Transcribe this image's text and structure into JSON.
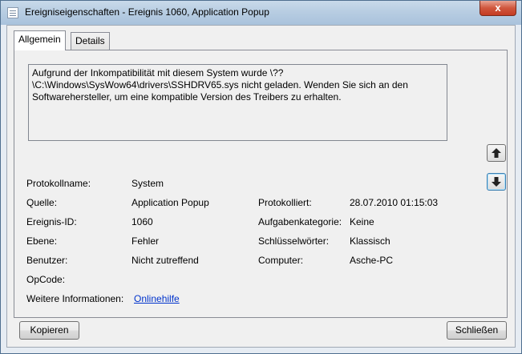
{
  "window": {
    "title": "Ereigniseigenschaften - Ereignis 1060, Application Popup",
    "close_glyph": "x"
  },
  "tabs": [
    {
      "label": "Allgemein",
      "active": true
    },
    {
      "label": "Details",
      "active": false
    }
  ],
  "message": "Aufgrund der Inkompatibilität mit diesem System wurde \\??\\C:\\Windows\\SysWow64\\drivers\\SSHDRV65.sys nicht geladen. Wenden Sie sich an den Softwarehersteller, um eine kompatible Version des Treibers zu erhalten.",
  "fields": {
    "protokollname": {
      "label": "Protokollname:",
      "value": "System"
    },
    "quelle": {
      "label": "Quelle:",
      "value": "Application Popup"
    },
    "protokolliert": {
      "label": "Protokolliert:",
      "value": "28.07.2010 01:15:03"
    },
    "ereignis_id": {
      "label": "Ereignis-ID:",
      "value": "1060"
    },
    "aufgabenkategorie": {
      "label": "Aufgabenkategorie:",
      "value": "Keine"
    },
    "ebene": {
      "label": "Ebene:",
      "value": "Fehler"
    },
    "schluesselwoerter": {
      "label": "Schlüsselwörter:",
      "value": "Klassisch"
    },
    "benutzer": {
      "label": "Benutzer:",
      "value": "Nicht zutreffend"
    },
    "computer": {
      "label": "Computer:",
      "value": "Asche-PC"
    },
    "opcode": {
      "label": "OpCode:",
      "value": ""
    },
    "weitere_informationen": {
      "label": "Weitere Informationen:",
      "value": "Onlinehilfe"
    }
  },
  "nav": {
    "up_icon": "arrow-up-icon",
    "down_icon": "arrow-down-icon"
  },
  "buttons": {
    "copy_label": "Kopieren",
    "close_label": "Schließen"
  },
  "colors": {
    "link": "#0033cc",
    "close_button": "#c43b22",
    "titlebar": "#b8cde2"
  }
}
